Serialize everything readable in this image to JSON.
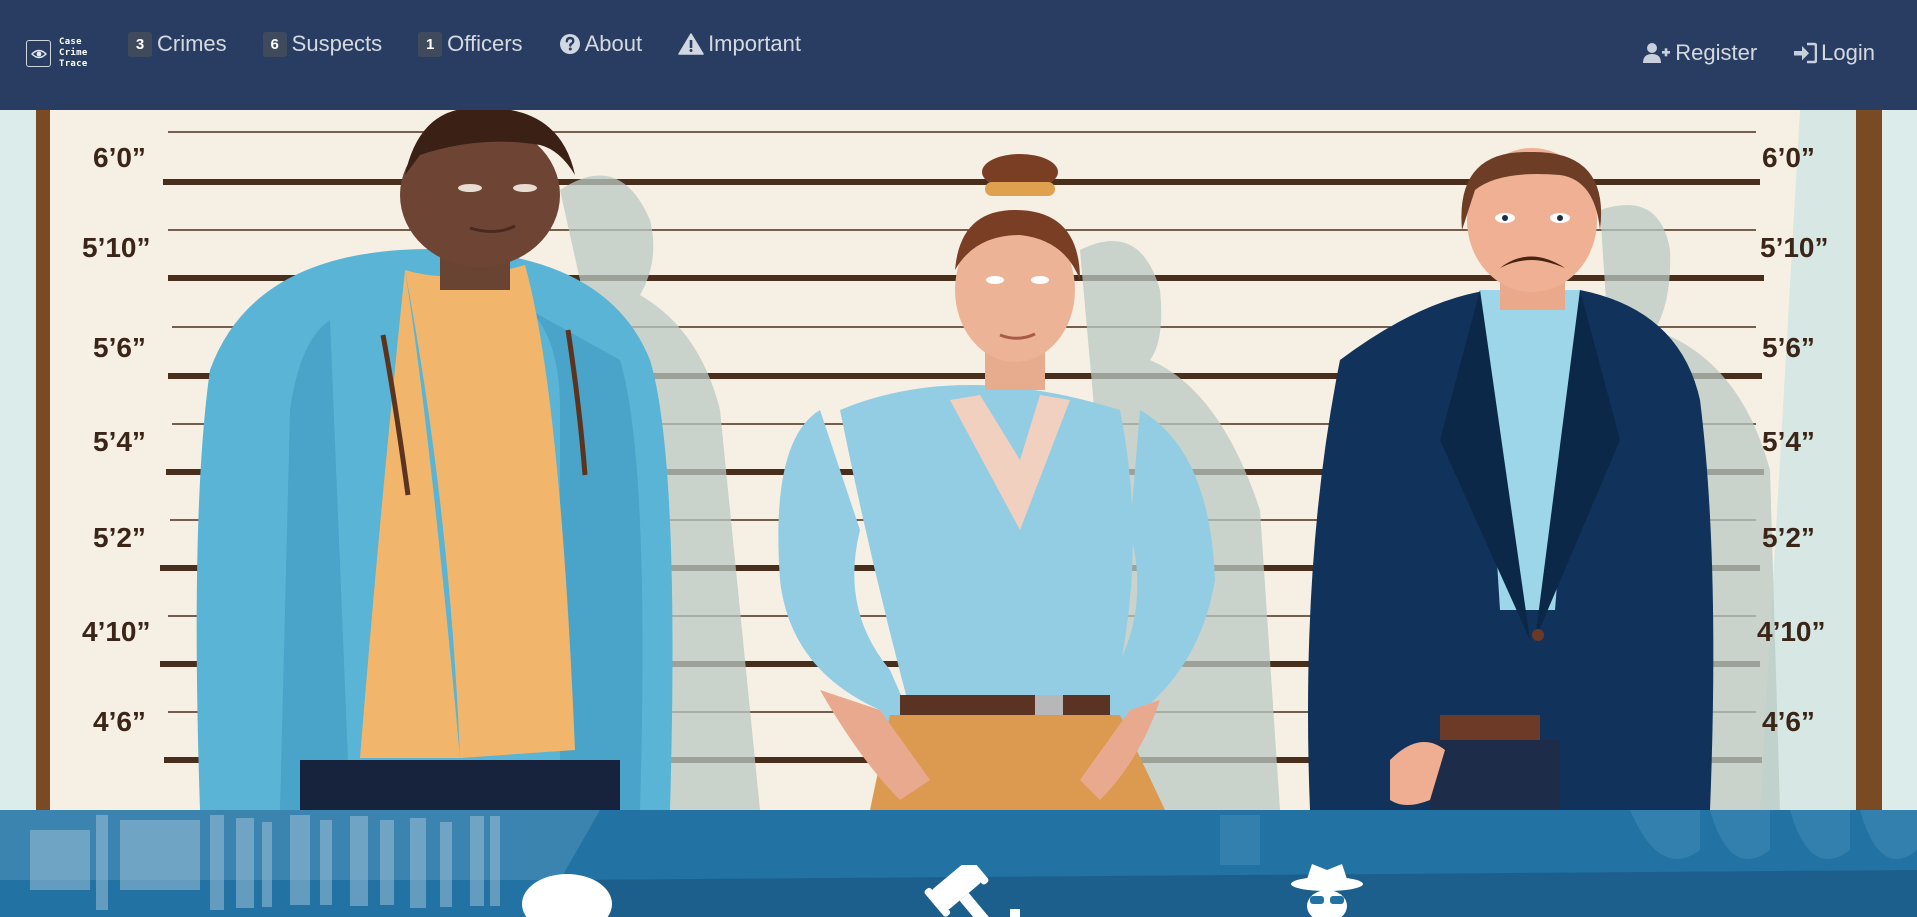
{
  "brand": {
    "line1": "Case",
    "line2": "Crime",
    "line3": "Trace",
    "icon": "eye-logo-icon"
  },
  "nav": {
    "items": [
      {
        "key": "crimes",
        "badge": "3",
        "label": "Crimes"
      },
      {
        "key": "suspects",
        "badge": "6",
        "label": "Suspects"
      },
      {
        "key": "officers",
        "badge": "1",
        "label": "Officers"
      },
      {
        "key": "about",
        "icon": "question-circle-icon",
        "label": "About"
      },
      {
        "key": "important",
        "icon": "warning-triangle-icon",
        "label": "Important"
      }
    ],
    "register": {
      "icon": "user-plus-icon",
      "label": "Register"
    },
    "login": {
      "icon": "sign-in-icon",
      "label": "Login"
    }
  },
  "lineup": {
    "heights_left": [
      "6’0”",
      "5’10”",
      "5’6”",
      "5’4”",
      "5’2”",
      "4’10”",
      "4’6”"
    ],
    "heights_right": [
      "6’0”",
      "5’10”",
      "5’6”",
      "5’4”",
      "5’2”",
      "4’10”",
      "4’6”"
    ]
  },
  "band_icons": [
    "speech-bubble-icon",
    "gavel-icon",
    "detective-icon"
  ],
  "colors": {
    "navbar": "#283d61",
    "band": "#1f6a9c",
    "badge": "#3f4b5c",
    "height_text": "#3a2518"
  }
}
